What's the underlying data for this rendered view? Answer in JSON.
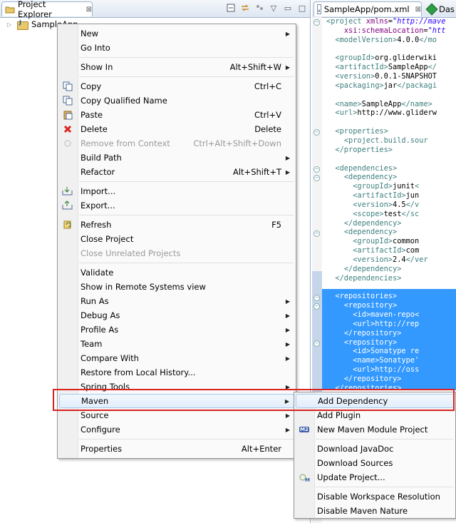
{
  "explorer": {
    "tab_title": "Project Explorer",
    "tab_close": "⊠",
    "project_name": "SampleApp"
  },
  "editor": {
    "active_tab": "SampleApp/pom.xml",
    "active_tab_close": "⊠",
    "other_tab": "Das",
    "code_lines": [
      {
        "parts": [
          [
            "tag",
            "<project "
          ],
          [
            "attr",
            "xmlns"
          ],
          [
            "txt",
            "="
          ],
          [
            "val",
            "\"http://mave"
          ]
        ]
      },
      {
        "parts": [
          [
            "txt",
            "    "
          ],
          [
            "attr",
            "xsi:schemaLocation"
          ],
          [
            "txt",
            "="
          ],
          [
            "val",
            "\"htt"
          ]
        ]
      },
      {
        "parts": [
          [
            "txt",
            "  "
          ],
          [
            "tag",
            "<modelVersion>"
          ],
          [
            "txt",
            "4.0.0"
          ],
          [
            "tag",
            "</mo"
          ]
        ]
      },
      {
        "parts": []
      },
      {
        "parts": [
          [
            "txt",
            "  "
          ],
          [
            "tag",
            "<groupId>"
          ],
          [
            "txt",
            "org.gliderwiki"
          ]
        ]
      },
      {
        "parts": [
          [
            "txt",
            "  "
          ],
          [
            "tag",
            "<artifactId>"
          ],
          [
            "txt",
            "SampleApp"
          ],
          [
            "tag",
            "</"
          ]
        ]
      },
      {
        "parts": [
          [
            "txt",
            "  "
          ],
          [
            "tag",
            "<version>"
          ],
          [
            "txt",
            "0.0.1-SNAPSHOT"
          ]
        ]
      },
      {
        "parts": [
          [
            "txt",
            "  "
          ],
          [
            "tag",
            "<packaging>"
          ],
          [
            "txt",
            "jar"
          ],
          [
            "tag",
            "</packagi"
          ]
        ]
      },
      {
        "parts": []
      },
      {
        "parts": [
          [
            "txt",
            "  "
          ],
          [
            "tag",
            "<name>"
          ],
          [
            "txt",
            "SampleApp"
          ],
          [
            "tag",
            "</name>"
          ]
        ]
      },
      {
        "parts": [
          [
            "txt",
            "  "
          ],
          [
            "tag",
            "<url>"
          ],
          [
            "txt",
            "http://www.gliderw"
          ]
        ]
      },
      {
        "parts": []
      },
      {
        "parts": [
          [
            "txt",
            "  "
          ],
          [
            "tag",
            "<properties>"
          ]
        ]
      },
      {
        "parts": [
          [
            "txt",
            "    "
          ],
          [
            "tag",
            "<project.build.sour"
          ]
        ]
      },
      {
        "parts": [
          [
            "txt",
            "  "
          ],
          [
            "tag",
            "</properties>"
          ]
        ]
      },
      {
        "parts": []
      },
      {
        "parts": [
          [
            "txt",
            "  "
          ],
          [
            "tag",
            "<dependencies>"
          ]
        ]
      },
      {
        "parts": [
          [
            "txt",
            "    "
          ],
          [
            "tag",
            "<dependency>"
          ]
        ]
      },
      {
        "parts": [
          [
            "txt",
            "      "
          ],
          [
            "tag",
            "<groupId>"
          ],
          [
            "txt",
            "junit"
          ],
          [
            "tag",
            "<"
          ]
        ]
      },
      {
        "parts": [
          [
            "txt",
            "      "
          ],
          [
            "tag",
            "<artifactId>"
          ],
          [
            "txt",
            "jun"
          ]
        ]
      },
      {
        "parts": [
          [
            "txt",
            "      "
          ],
          [
            "tag",
            "<version>"
          ],
          [
            "txt",
            "4.5"
          ],
          [
            "tag",
            "</v"
          ]
        ]
      },
      {
        "parts": [
          [
            "txt",
            "      "
          ],
          [
            "tag",
            "<scope>"
          ],
          [
            "txt",
            "test"
          ],
          [
            "tag",
            "</sc"
          ]
        ]
      },
      {
        "parts": [
          [
            "txt",
            "    "
          ],
          [
            "tag",
            "</dependency>"
          ]
        ]
      },
      {
        "parts": [
          [
            "txt",
            "    "
          ],
          [
            "tag",
            "<dependency>"
          ]
        ]
      },
      {
        "parts": [
          [
            "txt",
            "      "
          ],
          [
            "tag",
            "<groupId>"
          ],
          [
            "txt",
            "common"
          ]
        ]
      },
      {
        "parts": [
          [
            "txt",
            "      "
          ],
          [
            "tag",
            "<artifactId>"
          ],
          [
            "txt",
            "com"
          ]
        ]
      },
      {
        "parts": [
          [
            "txt",
            "      "
          ],
          [
            "tag",
            "<version>"
          ],
          [
            "txt",
            "2.4"
          ],
          [
            "tag",
            "</ver"
          ]
        ]
      },
      {
        "parts": [
          [
            "txt",
            "    "
          ],
          [
            "tag",
            "</dependency>"
          ]
        ]
      },
      {
        "parts": [
          [
            "txt",
            "  "
          ],
          [
            "tag",
            "</dependencies>"
          ]
        ]
      },
      {
        "parts": []
      },
      {
        "parts": [
          [
            "txt",
            "  "
          ],
          [
            "tag",
            "<repositories>"
          ]
        ]
      },
      {
        "parts": [
          [
            "txt",
            "    "
          ],
          [
            "tag",
            "<repository>"
          ]
        ]
      },
      {
        "parts": [
          [
            "txt",
            "      "
          ],
          [
            "tag",
            "<id>"
          ],
          [
            "txt",
            "maven-repo"
          ],
          [
            "tag",
            "<"
          ]
        ]
      },
      {
        "parts": [
          [
            "txt",
            "      "
          ],
          [
            "tag",
            "<url>"
          ],
          [
            "txt",
            "http://rep"
          ]
        ]
      },
      {
        "parts": [
          [
            "txt",
            "    "
          ],
          [
            "tag",
            "</repository>"
          ]
        ]
      },
      {
        "parts": [
          [
            "txt",
            "    "
          ],
          [
            "tag",
            "<repository>"
          ]
        ]
      },
      {
        "parts": [
          [
            "txt",
            "      "
          ],
          [
            "tag",
            "<id>"
          ],
          [
            "txt",
            "Sonatype re"
          ]
        ]
      },
      {
        "parts": [
          [
            "txt",
            "      "
          ],
          [
            "tag",
            "<name>"
          ],
          [
            "txt",
            "Sonatype'"
          ]
        ]
      },
      {
        "parts": [
          [
            "txt",
            "      "
          ],
          [
            "tag",
            "<url>"
          ],
          [
            "txt",
            "http://oss"
          ]
        ]
      },
      {
        "parts": [
          [
            "txt",
            "    "
          ],
          [
            "tag",
            "</repository>"
          ]
        ]
      },
      {
        "parts": [
          [
            "txt",
            "  "
          ],
          [
            "tag",
            "</repositories>"
          ]
        ]
      }
    ]
  },
  "context_menu": {
    "items": [
      {
        "label": "New",
        "arrow": true
      },
      {
        "label": "Go Into"
      },
      {
        "sep": true
      },
      {
        "label": "Show In",
        "shortcut": "Alt+Shift+W",
        "arrow": true
      },
      {
        "sep": true
      },
      {
        "label": "Copy",
        "shortcut": "Ctrl+C",
        "icon": "copy-icon"
      },
      {
        "label": "Copy Qualified Name",
        "icon": "copy-qualified-icon"
      },
      {
        "label": "Paste",
        "shortcut": "Ctrl+V",
        "icon": "paste-icon"
      },
      {
        "label": "Delete",
        "shortcut": "Delete",
        "icon": "delete-icon"
      },
      {
        "label": "Remove from Context",
        "shortcut": "Ctrl+Alt+Shift+Down",
        "disabled": true,
        "icon": "remove-context-icon"
      },
      {
        "label": "Build Path",
        "arrow": true
      },
      {
        "label": "Refactor",
        "shortcut": "Alt+Shift+T",
        "arrow": true
      },
      {
        "sep": true
      },
      {
        "label": "Import...",
        "icon": "import-icon"
      },
      {
        "label": "Export...",
        "icon": "export-icon"
      },
      {
        "sep": true
      },
      {
        "label": "Refresh",
        "shortcut": "F5",
        "icon": "refresh-icon"
      },
      {
        "label": "Close Project"
      },
      {
        "label": "Close Unrelated Projects",
        "disabled": true
      },
      {
        "sep": true
      },
      {
        "label": "Validate"
      },
      {
        "label": "Show in Remote Systems view"
      },
      {
        "label": "Run As",
        "arrow": true
      },
      {
        "label": "Debug As",
        "arrow": true
      },
      {
        "label": "Profile As",
        "arrow": true
      },
      {
        "label": "Team",
        "arrow": true
      },
      {
        "label": "Compare With",
        "arrow": true
      },
      {
        "label": "Restore from Local History..."
      },
      {
        "label": "Spring Tools",
        "arrow": true
      },
      {
        "label": "Maven",
        "arrow": true,
        "highlight": true
      },
      {
        "label": "Source",
        "arrow": true
      },
      {
        "label": "Configure",
        "arrow": true
      },
      {
        "sep": true
      },
      {
        "label": "Properties",
        "shortcut": "Alt+Enter"
      }
    ]
  },
  "maven_submenu": {
    "items": [
      {
        "label": "Add Dependency",
        "highlight": true
      },
      {
        "label": "Add Plugin"
      },
      {
        "label": "New Maven Module Project",
        "icon": "maven-module-icon"
      },
      {
        "sep": true
      },
      {
        "label": "Download JavaDoc"
      },
      {
        "label": "Download Sources"
      },
      {
        "label": "Update Project...",
        "icon": "update-project-icon"
      },
      {
        "sep": true
      },
      {
        "label": "Disable Workspace Resolution"
      },
      {
        "label": "Disable Maven Nature"
      }
    ]
  }
}
